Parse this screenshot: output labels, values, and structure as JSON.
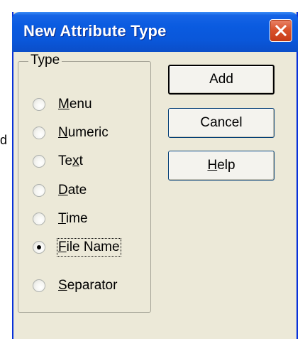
{
  "window": {
    "title": "New Attribute Type"
  },
  "background_glyph": "d",
  "group": {
    "legend": "Type",
    "options": [
      {
        "pre": "",
        "key": "M",
        "post": "enu",
        "selected": false
      },
      {
        "pre": "",
        "key": "N",
        "post": "umeric",
        "selected": false
      },
      {
        "pre": "Te",
        "key": "x",
        "post": "t",
        "selected": false
      },
      {
        "pre": "",
        "key": "D",
        "post": "ate",
        "selected": false
      },
      {
        "pre": "",
        "key": "T",
        "post": "ime",
        "selected": false
      },
      {
        "pre": "",
        "key": "F",
        "post": "ile Name",
        "selected": true
      },
      {
        "pre": "",
        "key": "S",
        "post": "eparator",
        "selected": false
      }
    ]
  },
  "buttons": {
    "add": "Add",
    "cancel": "Cancel",
    "help": {
      "pre": "",
      "key": "H",
      "post": "elp"
    }
  },
  "colors": {
    "titlebar": "#0a5be0",
    "dialog_bg": "#ece9d8",
    "close": "#d9532c"
  },
  "icons": {
    "close": "close-x-icon",
    "radio": "radio-button-icon"
  }
}
